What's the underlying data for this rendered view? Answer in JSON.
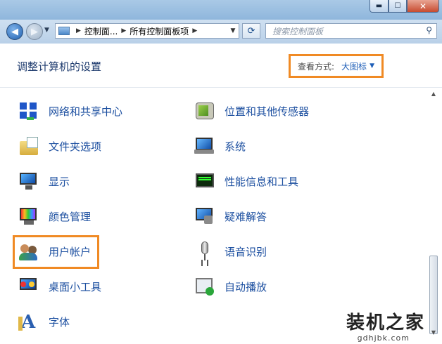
{
  "window": {
    "min_label": "▬",
    "max_label": "☐",
    "close_label": "✕"
  },
  "navbar": {
    "back_glyph": "◀",
    "forward_glyph": "▶",
    "history_glyph": "▼",
    "breadcrumb": [
      "控制面...",
      "所有控制面板项"
    ],
    "breadcrumb_sep": "▶",
    "address_dropdown": "▼",
    "refresh_glyph": "⟳",
    "search_placeholder": "搜索控制面板"
  },
  "header": {
    "title": "调整计算机的设置",
    "view_label": "查看方式:",
    "view_value": "大图标",
    "view_arrow": "▼"
  },
  "items_left": [
    {
      "label": "网络和共享中心",
      "icon": "network-icon"
    },
    {
      "label": "文件夹选项",
      "icon": "folder-options-icon"
    },
    {
      "label": "显示",
      "icon": "display-icon"
    },
    {
      "label": "颜色管理",
      "icon": "color-management-icon"
    },
    {
      "label": "用户帐户",
      "icon": "user-accounts-icon"
    },
    {
      "label": "桌面小工具",
      "icon": "desktop-gadgets-icon"
    },
    {
      "label": "字体",
      "icon": "fonts-icon"
    }
  ],
  "items_right": [
    {
      "label": "位置和其他传感器",
      "icon": "location-sensors-icon"
    },
    {
      "label": "系统",
      "icon": "system-icon"
    },
    {
      "label": "性能信息和工具",
      "icon": "performance-icon"
    },
    {
      "label": "疑难解答",
      "icon": "troubleshooting-icon"
    },
    {
      "label": "语音识别",
      "icon": "speech-recognition-icon"
    },
    {
      "label": "自动播放",
      "icon": "autoplay-icon"
    }
  ],
  "scrollbar": {
    "up": "▲",
    "down": "▼"
  },
  "watermark": {
    "text": "装机之家",
    "url": "gdhjbk.com"
  }
}
